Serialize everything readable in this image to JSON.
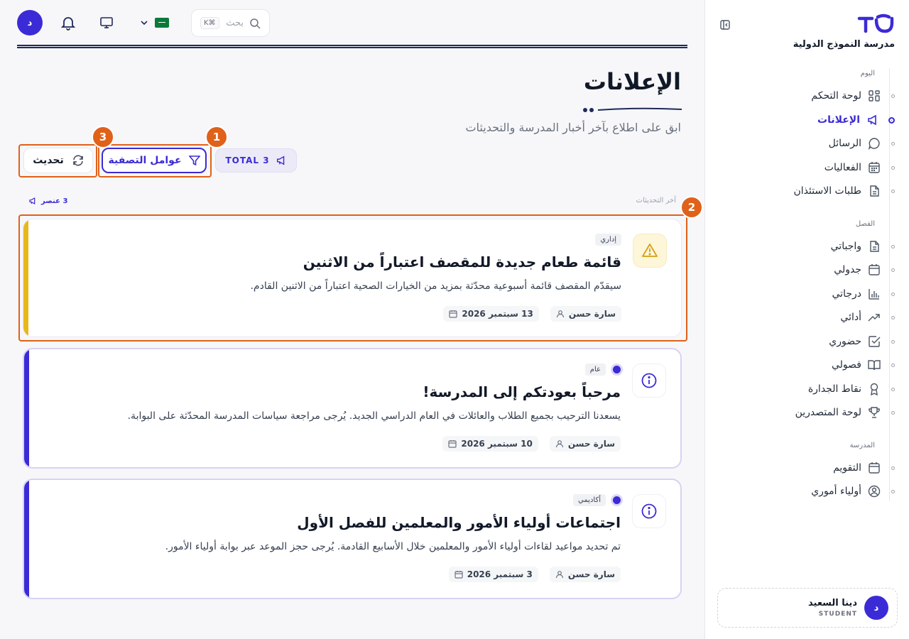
{
  "brand": {
    "accent": "#3b2bd6",
    "warning": "#e8b71a",
    "annotation": "#e0611a"
  },
  "sidebar": {
    "school_name": "مدرسة النموذج الدولية",
    "sections": [
      {
        "title": "اليوم",
        "items": [
          {
            "label": "لوحة التحكم",
            "icon": "dashboard-icon"
          },
          {
            "label": "الإعلانات",
            "icon": "megaphone-icon",
            "active": true
          },
          {
            "label": "الرسائل",
            "icon": "chat-icon"
          },
          {
            "label": "الفعاليات",
            "icon": "calendar-grid-icon"
          },
          {
            "label": "طلبات الاستئذان",
            "icon": "document-icon"
          }
        ]
      },
      {
        "title": "الفصل",
        "items": [
          {
            "label": "واجباتي",
            "icon": "document-icon"
          },
          {
            "label": "جدولي",
            "icon": "calendar-icon"
          },
          {
            "label": "درجاتي",
            "icon": "bar-chart-icon"
          },
          {
            "label": "أدائي",
            "icon": "trending-up-icon"
          },
          {
            "label": "حضوري",
            "icon": "check-square-icon"
          },
          {
            "label": "فصولي",
            "icon": "book-icon"
          },
          {
            "label": "نقاط الجدارة",
            "icon": "award-icon"
          },
          {
            "label": "لوحة المتصدرين",
            "icon": "trophy-icon"
          }
        ]
      },
      {
        "title": "المدرسة",
        "items": [
          {
            "label": "التقويم",
            "icon": "calendar-icon"
          },
          {
            "label": "أولياء أموري",
            "icon": "user-circle-icon"
          }
        ]
      }
    ],
    "profile": {
      "initial": "د",
      "name": "دينا السعيد",
      "role": "STUDENT"
    }
  },
  "topbar": {
    "avatar_initial": "د",
    "search": {
      "placeholder": "بحث",
      "shortcut": "K⌘"
    }
  },
  "page": {
    "title": "الإعلانات",
    "subtitle": "ابق على اطلاع بآخر أخبار المدرسة والتحديثات",
    "total_label": "TOTAL 3",
    "filters_label": "عوامل التصفية",
    "refresh_label": "تحديث",
    "latest_label": "آخر التحديثات",
    "count_label": "3 عنصر"
  },
  "annotations": [
    "1",
    "2",
    "3"
  ],
  "announcements": [
    {
      "category": "إداري",
      "title": "قائمة طعام جديدة للمقصف اعتباراً من الاثنين",
      "body": "سيقدّم المقصف قائمة أسبوعية محدّثة بمزيد من الخيارات الصحية اعتباراً من الاثنين القادم.",
      "author": "سارة حسن",
      "date": "13 سبتمبر 2026",
      "icon": "warning-icon",
      "unread": false
    },
    {
      "category": "عام",
      "title": "مرحباً بعودتكم إلى المدرسة!",
      "body": "يسعدنا الترحيب بجميع الطلاب والعائلات في العام الدراسي الجديد. يُرجى مراجعة سياسات المدرسة المحدّثة على البوابة.",
      "author": "سارة حسن",
      "date": "10 سبتمبر 2026",
      "icon": "info-icon",
      "unread": true
    },
    {
      "category": "أكاديمي",
      "title": "اجتماعات أولياء الأمور والمعلمين للفصل الأول",
      "body": "تم تحديد مواعيد لقاءات أولياء الأمور والمعلمين خلال الأسابيع القادمة. يُرجى حجز الموعد عبر بوابة أولياء الأمور.",
      "author": "سارة حسن",
      "date": "3 سبتمبر 2026",
      "icon": "info-icon",
      "unread": true
    }
  ]
}
